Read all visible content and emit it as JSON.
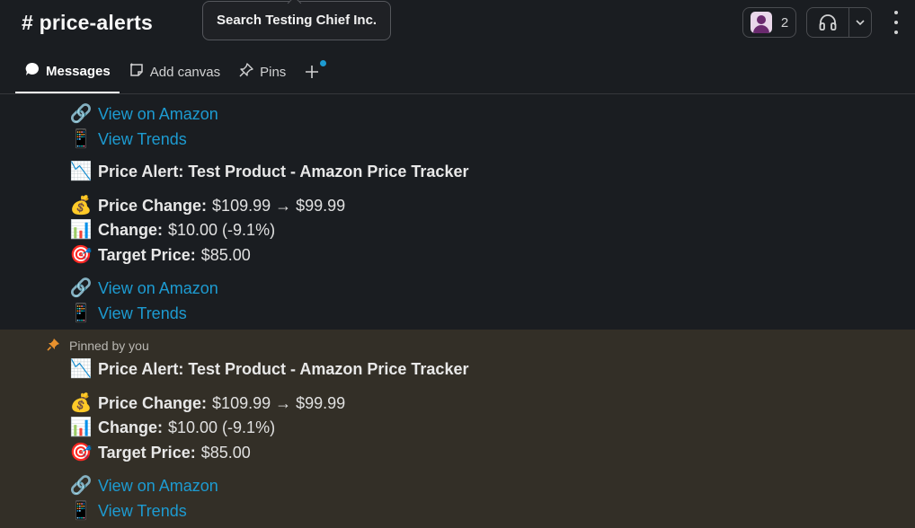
{
  "header": {
    "channel_name": "# price-alerts",
    "tooltip": "Search Testing Chief Inc.",
    "member_count": "2"
  },
  "tabs": [
    {
      "label": "Messages",
      "icon": "message-bubble-icon"
    },
    {
      "label": "Add canvas",
      "icon": "canvas-icon"
    },
    {
      "label": "Pins",
      "icon": "pin-icon"
    }
  ],
  "messages": {
    "top_links": [
      "View on Amazon",
      "View Trends"
    ],
    "alert1": {
      "title": "Price Alert: Test Product - Amazon Price Tracker",
      "price_change_label": "Price Change:",
      "price_change_value": "$109.99 → $99.99",
      "change_label": "Change:",
      "change_value": "$10.00 (-9.1%)",
      "target_label": "Target Price:",
      "target_value": "$85.00",
      "links": [
        "View on Amazon",
        "View Trends"
      ]
    },
    "pinned_label": "Pinned by you",
    "alert2": {
      "title": "Price Alert: Test Product - Amazon Price Tracker",
      "price_change_label": "Price Change:",
      "price_change_value": "$109.99 → $99.99",
      "change_label": "Change:",
      "change_value": "$10.00 (-9.1%)",
      "target_label": "Target Price:",
      "target_value": "$85.00",
      "links": [
        "View on Amazon",
        "View Trends"
      ]
    }
  },
  "emoji": {
    "link": "🔗",
    "phone": "📱",
    "chart_down": "📉",
    "money_bag": "💰",
    "bar_chart": "📊",
    "target": "🎯"
  },
  "colors": {
    "background": "#1a1d21",
    "pinned_background": "#332f27",
    "link": "#1d9bd1",
    "pin": "#e8912d",
    "notification_dot": "#1d9bd1"
  }
}
